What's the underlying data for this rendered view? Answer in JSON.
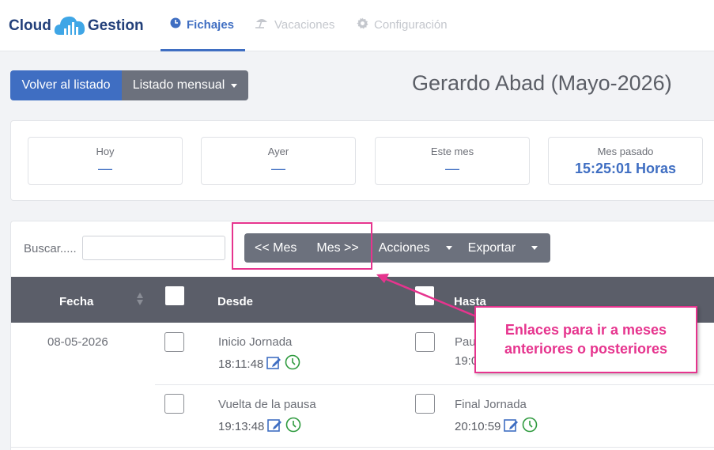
{
  "brand": {
    "name_left": "Cloud",
    "name_right": "Gestion",
    "brand_color": "#23407a",
    "accent": "#3f6ec2"
  },
  "nav": {
    "tabs": [
      {
        "label": "Fichajes",
        "icon": "clock-icon",
        "active": true
      },
      {
        "label": "Vacaciones",
        "icon": "beach-umbrella-icon",
        "active": false
      },
      {
        "label": "Configuración",
        "icon": "gear-icon",
        "active": false
      }
    ]
  },
  "header": {
    "back_button": "Volver al listado",
    "view_dropdown": "Listado mensual",
    "title": "Gerardo Abad (Mayo-2026)"
  },
  "stats": [
    {
      "label": "Hoy",
      "value": "—"
    },
    {
      "label": "Ayer",
      "value": "—"
    },
    {
      "label": "Este mes",
      "value": "—"
    },
    {
      "label": "Mes pasado",
      "value": "15:25:01 Horas"
    }
  ],
  "toolbar": {
    "search_label": "Buscar.....",
    "search_value": "",
    "prev_month": "<< Mes",
    "next_month": "Mes >>",
    "actions": "Acciones",
    "export": "Exportar"
  },
  "table": {
    "columns": {
      "fecha": "Fecha",
      "desde": "Desde",
      "hasta": "Hasta"
    },
    "rows": [
      {
        "fecha": "08-05-2026",
        "entries": [
          {
            "desde_label": "Inicio Jornada",
            "desde_time": "18:11:48",
            "hasta_label": "Pau",
            "hasta_time": "19:0"
          },
          {
            "desde_label": "Vuelta de la pausa",
            "desde_time": "19:13:48",
            "hasta_label": "Final Jornada",
            "hasta_time": "20:10:59"
          }
        ]
      }
    ]
  },
  "annotation": {
    "text_line1": "Enlaces para ir a meses",
    "text_line2": "anteriores o posteriores",
    "color": "#e6348e"
  }
}
